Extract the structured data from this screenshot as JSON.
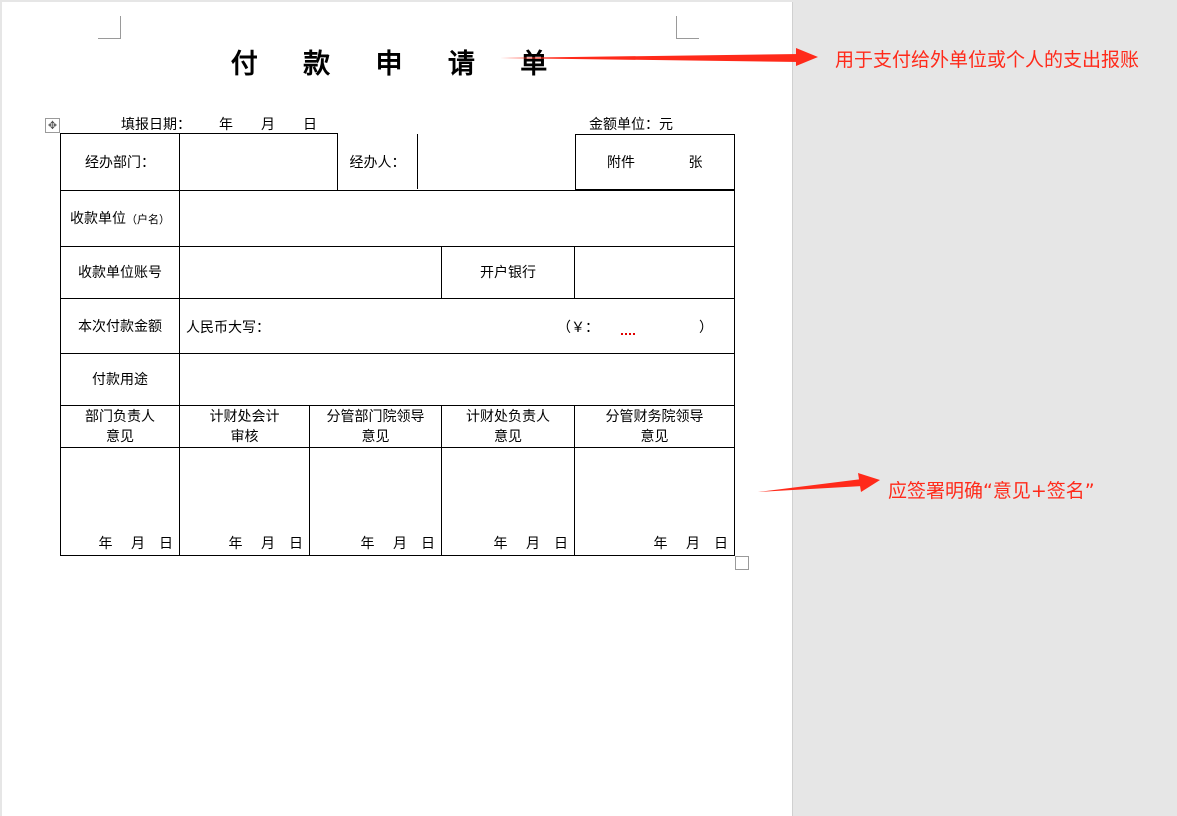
{
  "title": "付 款 申 请 单",
  "header": {
    "date_label": "填报日期：",
    "date_year": "年",
    "date_month": "月",
    "date_day": "日",
    "unit_label": "金额单位：元"
  },
  "table": {
    "handler_dept": "经办部门：",
    "handler": "经办人：",
    "attachment": "附件",
    "attachment_unit": "张",
    "payee_unit": "收款单位",
    "payee_unit_sub": "（户名）",
    "payee_account": "收款单位账号",
    "bank": "开户银行",
    "amount": "本次付款金额",
    "amount_rmb": "人民币大写：",
    "amount_yen_open": "（￥：",
    "amount_yen_close": "）",
    "purpose": "付款用途",
    "approvers": [
      {
        "line1": "部门负责人",
        "line2": "意见"
      },
      {
        "line1": "计财处会计",
        "line2": "审核"
      },
      {
        "line1": "分管部门院领导",
        "line2": "意见"
      },
      {
        "line1": "计财处负责人",
        "line2": "意见"
      },
      {
        "line1": "分管财务院领导",
        "line2": "意见"
      }
    ],
    "sign_date": "年　 月　日"
  },
  "annotations": {
    "title_note": "用于支付给外单位或个人的支出报账",
    "sign_note": "应签署明确“意见+签名”",
    "color": "#ff2a1a"
  }
}
